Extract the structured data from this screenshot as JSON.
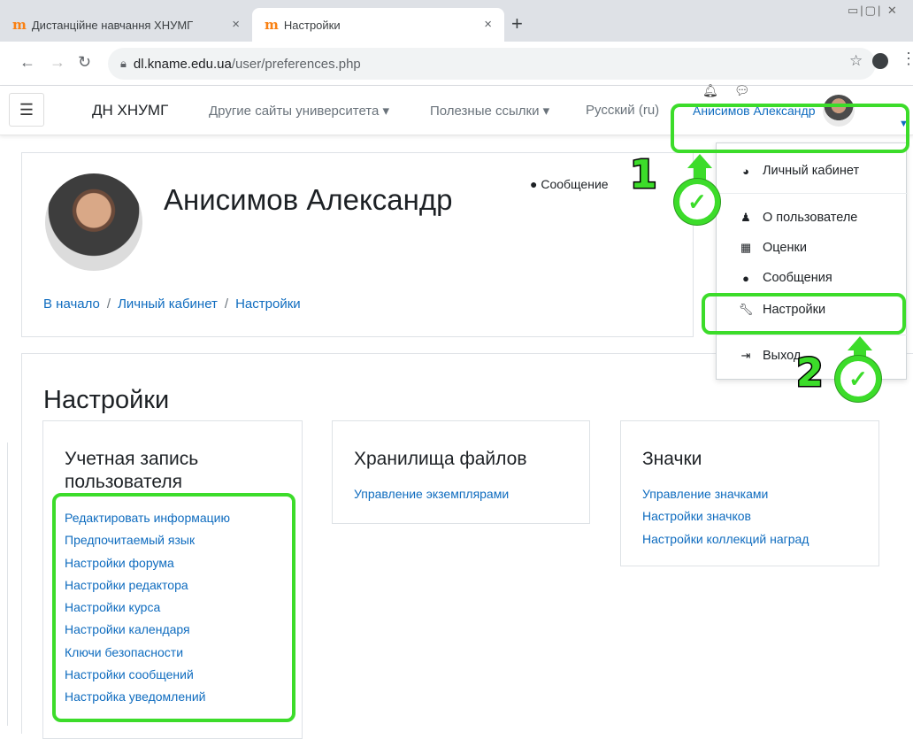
{
  "browser": {
    "tabs": [
      {
        "label": "Дистанційне навчання ХНУМГ",
        "close": "×"
      },
      {
        "label": "Настройки",
        "close": "×"
      }
    ],
    "new_tab": "+",
    "url_host": "dl.kname.edu.ua",
    "url_path": "/user/preferences.php"
  },
  "navbar": {
    "brand": "ДН ХНУМГ",
    "menus": [
      "Другие сайты университета ▾",
      "Полезные ссылки ▾",
      "Русский (ru)"
    ],
    "user_name": "Анисимов Александр"
  },
  "header": {
    "full_name": "Анисимов Александр",
    "message_button": "Сообщение",
    "breadcrumbs": [
      "В начало",
      "Личный кабинет",
      "Настройки"
    ],
    "separator": "/"
  },
  "page_title": "Настройки",
  "sections": [
    {
      "title": "Учетная запись пользователя",
      "links": [
        "Редактировать информацию",
        "Предпочитаемый язык",
        "Настройки форума",
        "Настройки редактора",
        "Настройки курса",
        "Настройки календаря",
        "Ключи безопасности",
        "Настройки сообщений",
        "Настройка уведомлений"
      ]
    },
    {
      "title": "Хранилища файлов",
      "links": [
        "Управление экземплярами"
      ]
    },
    {
      "title": "Значки",
      "links": [
        "Управление значками",
        "Настройки значков",
        "Настройки коллекций наград"
      ]
    }
  ],
  "user_dropdown": [
    {
      "label": "Личный кабинет",
      "icon": "dashboard-icon"
    },
    {
      "label": "О пользователе",
      "icon": "user-icon"
    },
    {
      "label": "Оценки",
      "icon": "grades-icon"
    },
    {
      "label": "Сообщения",
      "icon": "message-icon"
    },
    {
      "label": "Настройки",
      "icon": "wrench-icon"
    },
    {
      "label": "Выход",
      "icon": "logout-icon"
    }
  ],
  "annotations": {
    "step1": "1",
    "step2": "2",
    "highlight_color": "#3cdc2a"
  }
}
